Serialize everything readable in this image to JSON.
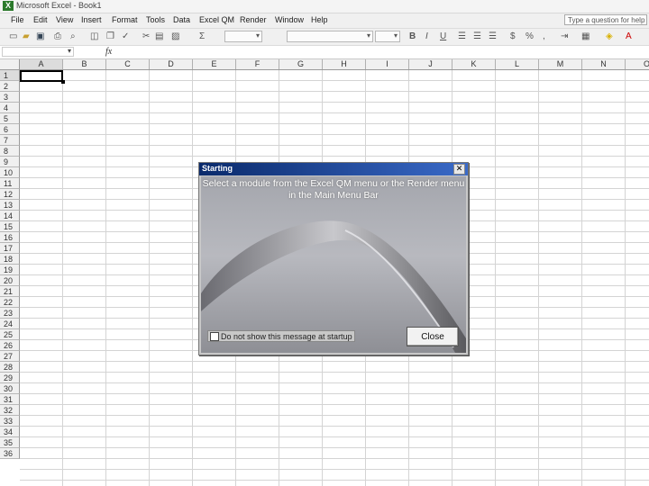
{
  "window": {
    "title": "Microsoft Excel - Book1"
  },
  "menubar": {
    "items": [
      "File",
      "Edit",
      "View",
      "Insert",
      "Format",
      "Tools",
      "Data",
      "Excel QM",
      "Render",
      "Window",
      "Help"
    ],
    "help_placeholder": "Type a question for help"
  },
  "formula_bar": {
    "name_box": "",
    "fx_label": "fx",
    "formula": ""
  },
  "sheet": {
    "columns": [
      "A",
      "B",
      "C",
      "D",
      "E",
      "F",
      "G",
      "H",
      "I",
      "J",
      "K",
      "L",
      "M",
      "N",
      "O"
    ],
    "rows": [
      "1",
      "2",
      "3",
      "4",
      "5",
      "6",
      "7",
      "8",
      "9",
      "10",
      "11",
      "12",
      "13",
      "14",
      "15",
      "16",
      "17",
      "18",
      "19",
      "20",
      "21",
      "22",
      "23",
      "24",
      "25",
      "26",
      "27",
      "28",
      "29",
      "30",
      "31",
      "32",
      "33",
      "34",
      "35",
      "36"
    ],
    "active_cell": "A1"
  },
  "dialog": {
    "title": "Starting",
    "message": "Select a module from the Excel QM menu or the Render menu in the Main Menu Bar",
    "checkbox_label": "Do not show this message at startup",
    "checkbox_checked": false,
    "close_label": "Close"
  },
  "colors": {
    "title_bar_start": "#0a2a6b",
    "title_bar_end": "#3a6ac8",
    "grid_line": "#d4d4d4"
  },
  "toolbar_icons": [
    "new-icon",
    "open-icon",
    "save-icon",
    "permission-icon",
    "print-icon",
    "print-preview-icon",
    "research-icon",
    "spelling-icon",
    "cut-icon",
    "copy-icon",
    "paste-icon",
    "format-painter-icon",
    "autosum-icon",
    "font-combo",
    "font-size-combo",
    "bold-icon",
    "italic-icon",
    "underline-icon",
    "align-left-icon",
    "center-icon",
    "align-right-icon",
    "currency-icon",
    "percent-icon",
    "comma-icon",
    "indent-icon",
    "borders-icon",
    "fill-color-icon",
    "font-color-icon"
  ]
}
